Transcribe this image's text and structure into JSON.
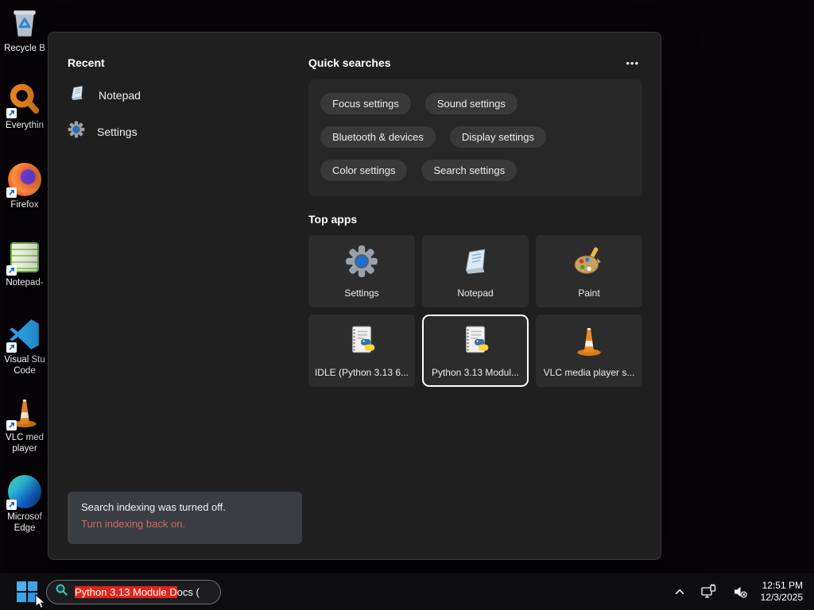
{
  "desktop": {
    "icons": [
      {
        "name": "recycle-bin",
        "lines": [
          "Recycle B"
        ]
      },
      {
        "name": "everything",
        "lines": [
          "Everythin"
        ]
      },
      {
        "name": "firefox",
        "lines": [
          "Firefox"
        ]
      },
      {
        "name": "notepad-plus-plus",
        "lines": [
          "Notepad-"
        ]
      },
      {
        "name": "visual-studio-code",
        "lines": [
          "Visual Stu",
          "Code"
        ]
      },
      {
        "name": "vlc-media-player",
        "lines": [
          "VLC med",
          "player"
        ]
      },
      {
        "name": "microsoft-edge",
        "lines": [
          "Microsof",
          "Edge"
        ]
      }
    ]
  },
  "search_panel": {
    "recent": {
      "header": "Recent",
      "items": [
        {
          "label": "Notepad",
          "icon": "notepad-icon"
        },
        {
          "label": "Settings",
          "icon": "settings-gear-icon"
        }
      ]
    },
    "quick_searches": {
      "header": "Quick searches",
      "more_icon": "•••",
      "pills": [
        "Focus settings",
        "Sound settings",
        "Bluetooth & devices",
        "Display settings",
        "Color settings",
        "Search settings"
      ]
    },
    "top_apps": {
      "header": "Top apps",
      "tiles": [
        {
          "label": "Settings",
          "icon": "settings-gear-icon",
          "selected": false
        },
        {
          "label": "Notepad",
          "icon": "notepad-icon",
          "selected": false
        },
        {
          "label": "Paint",
          "icon": "paint-palette-icon",
          "selected": false
        },
        {
          "label": "IDLE (Python 3.13 6...",
          "icon": "python-doc-icon",
          "selected": false
        },
        {
          "label": "Python 3.13 Modul...",
          "icon": "python-doc-icon",
          "selected": true
        },
        {
          "label": "VLC media player s...",
          "icon": "vlc-cone-icon",
          "selected": false
        }
      ]
    },
    "indexing_notice": {
      "message": "Search indexing was turned off.",
      "link_label": "Turn indexing back on."
    }
  },
  "taskbar": {
    "search_box": {
      "selected_text": "Python 3.13 Module D",
      "unselected_text": "ocs (",
      "selection_color": "#e0241c"
    },
    "tray": {
      "time": "12:51 PM",
      "date": "12/3/2025"
    }
  }
}
